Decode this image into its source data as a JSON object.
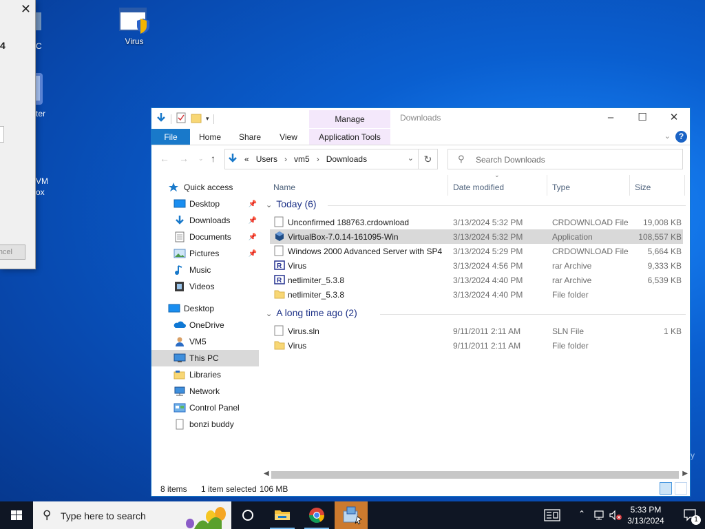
{
  "desktop": {
    "icons": [
      {
        "label": "Virus"
      },
      {
        "label": "C"
      },
      {
        "label": "ter"
      },
      {
        "label": "VM"
      },
      {
        "label": "ox"
      }
    ],
    "right_edge_char": "y"
  },
  "dialog": {
    "close": "✕",
    "number": "4",
    "cancel_label": "ncel"
  },
  "explorer": {
    "title": "Downloads",
    "contextual_header": "Manage",
    "ribbon_tabs": [
      "File",
      "Home",
      "Share",
      "View",
      "Application Tools"
    ],
    "breadcrumb": [
      "«",
      "Users",
      "›",
      "vm5",
      "›",
      "Downloads"
    ],
    "search_placeholder": "Search Downloads",
    "nav": [
      {
        "label": "Quick access",
        "pinned": false
      },
      {
        "label": "Desktop",
        "pinned": true
      },
      {
        "label": "Downloads",
        "pinned": true
      },
      {
        "label": "Documents",
        "pinned": true
      },
      {
        "label": "Pictures",
        "pinned": true
      },
      {
        "label": "Music",
        "pinned": false
      },
      {
        "label": "Videos",
        "pinned": false
      },
      {
        "label": "Desktop",
        "pinned": false
      },
      {
        "label": "OneDrive",
        "pinned": false
      },
      {
        "label": "VM5",
        "pinned": false
      },
      {
        "label": "This PC",
        "pinned": false,
        "selected": true
      },
      {
        "label": "Libraries",
        "pinned": false
      },
      {
        "label": "Network",
        "pinned": false
      },
      {
        "label": "Control Panel",
        "pinned": false
      },
      {
        "label": "bonzi buddy",
        "pinned": false
      }
    ],
    "columns": {
      "name": "Name",
      "date": "Date modified",
      "type": "Type",
      "size": "Size"
    },
    "groups": [
      {
        "label": "Today (6)",
        "files": [
          {
            "name": "Unconfirmed 188763.crdownload",
            "date": "3/13/2024 5:32 PM",
            "type": "CRDOWNLOAD File",
            "size": "19,008 KB",
            "icon": "blank-file-icon"
          },
          {
            "name": "VirtualBox-7.0.14-161095-Win",
            "date": "3/13/2024 5:32 PM",
            "type": "Application",
            "size": "108,557 KB",
            "icon": "virtualbox-icon",
            "selected": true
          },
          {
            "name": "Windows 2000 Advanced Server with SP4...",
            "date": "3/13/2024 5:29 PM",
            "type": "CRDOWNLOAD File",
            "size": "5,664 KB",
            "icon": "blank-file-icon"
          },
          {
            "name": "Virus",
            "date": "3/13/2024 4:56 PM",
            "type": "rar Archive",
            "size": "9,333 KB",
            "icon": "rar-icon"
          },
          {
            "name": "netlimiter_5.3.8",
            "date": "3/13/2024 4:40 PM",
            "type": "rar Archive",
            "size": "6,539 KB",
            "icon": "rar-icon"
          },
          {
            "name": "netlimiter_5.3.8",
            "date": "3/13/2024 4:40 PM",
            "type": "File folder",
            "size": "",
            "icon": "folder-icon"
          }
        ]
      },
      {
        "label": "A long time ago (2)",
        "files": [
          {
            "name": "Virus.sln",
            "date": "9/11/2011 2:11 AM",
            "type": "SLN File",
            "size": "1 KB",
            "icon": "blank-file-icon"
          },
          {
            "name": "Virus",
            "date": "9/11/2011 2:11 AM",
            "type": "File folder",
            "size": "",
            "icon": "folder-icon"
          }
        ]
      }
    ],
    "status": {
      "items": "8 items",
      "selected": "1 item selected",
      "size": "106 MB"
    }
  },
  "taskbar": {
    "search_placeholder": "Type here to search",
    "clock_time": "5:33 PM",
    "clock_date": "3/13/2024",
    "notification_count": "1"
  }
}
